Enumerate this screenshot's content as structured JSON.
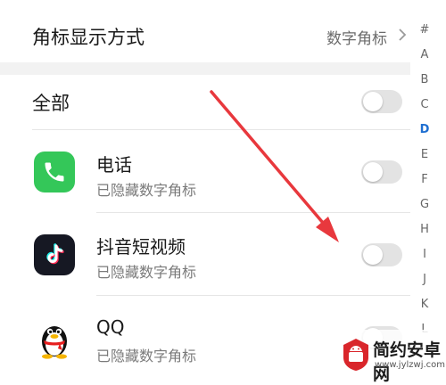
{
  "badge_setting": {
    "label": "角标显示方式",
    "value": "数字角标"
  },
  "all_toggle": {
    "label": "全部",
    "on": false
  },
  "apps": [
    {
      "name": "电话",
      "status": "已隐藏数字角标",
      "icon": "phone-icon",
      "on": false
    },
    {
      "name": "抖音短视频",
      "status": "已隐藏数字角标",
      "icon": "tiktok-icon",
      "on": false
    },
    {
      "name": "QQ",
      "status": "已隐藏数字角标",
      "icon": "qq-penguin-icon",
      "on": false
    }
  ],
  "index": [
    "#",
    "A",
    "B",
    "C",
    "D",
    "E",
    "F",
    "G",
    "H",
    "I",
    "J",
    "K",
    "L"
  ],
  "index_active": "D",
  "watermark": {
    "text": "简约安卓网",
    "url": "www.jylzwj.com"
  },
  "colors": {
    "accent": "#1f6fd1",
    "arrow": "#e8383d",
    "phone_green": "#34c759",
    "tiktok_bg": "#161823"
  }
}
